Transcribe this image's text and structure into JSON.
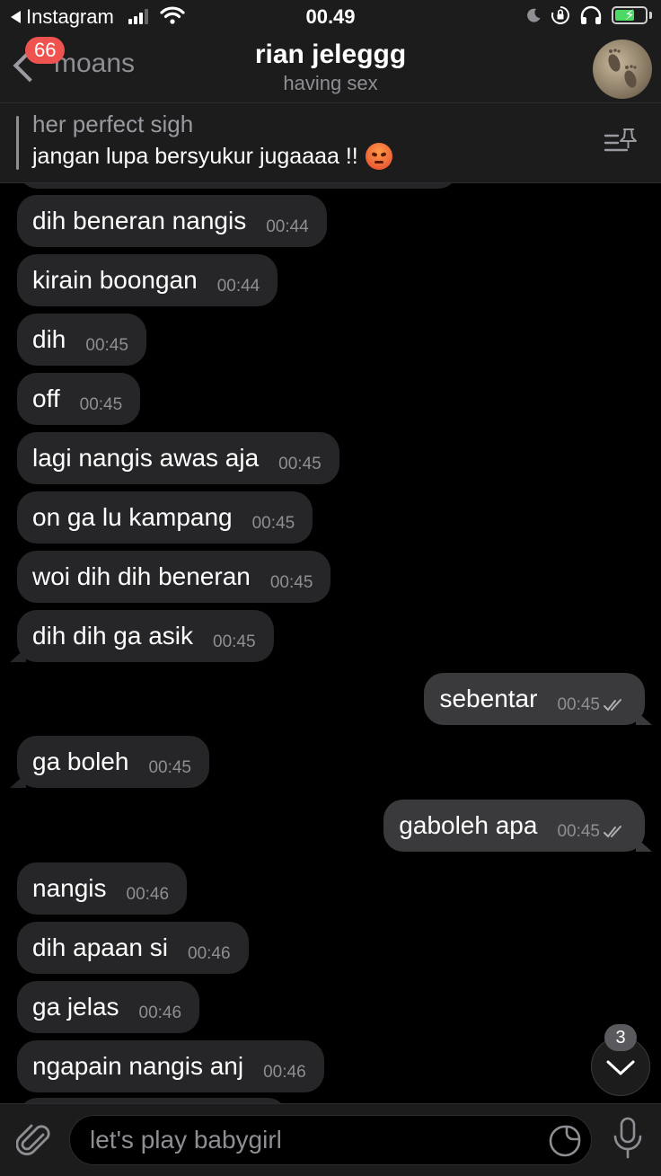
{
  "status_bar": {
    "back_app": "Instagram",
    "time": "00.49"
  },
  "header": {
    "back_label": "moans",
    "unread_badge": "66",
    "title": "rian jeleggg",
    "subtitle": "having sex"
  },
  "pinned": {
    "title": "her perfect sigh",
    "text": "jangan lupa bersyukur jugaaaa !!"
  },
  "messages": [
    {
      "text": "dih beneran nangis",
      "time": "00:44",
      "dir": "in"
    },
    {
      "text": "kirain boongan",
      "time": "00:44",
      "dir": "in"
    },
    {
      "text": "dih",
      "time": "00:45",
      "dir": "in"
    },
    {
      "text": "off",
      "time": "00:45",
      "dir": "in"
    },
    {
      "text": "lagi nangis awas aja",
      "time": "00:45",
      "dir": "in"
    },
    {
      "text": "on ga lu kampang",
      "time": "00:45",
      "dir": "in"
    },
    {
      "text": "woi dih dih beneran",
      "time": "00:45",
      "dir": "in"
    },
    {
      "text": "dih dih ga asik",
      "time": "00:45",
      "dir": "in"
    },
    {
      "text": "sebentar",
      "time": "00:45",
      "dir": "out"
    },
    {
      "text": "ga boleh",
      "time": "00:45",
      "dir": "in"
    },
    {
      "text": "gaboleh apa",
      "time": "00:45",
      "dir": "out"
    },
    {
      "text": "nangis",
      "time": "00:46",
      "dir": "in"
    },
    {
      "text": "dih apaan si",
      "time": "00:46",
      "dir": "in"
    },
    {
      "text": "ga jelas",
      "time": "00:46",
      "dir": "in"
    },
    {
      "text": "ngapain nangis anj",
      "time": "00:46",
      "dir": "in"
    }
  ],
  "scroll_down": {
    "unread_count": "3"
  },
  "composer": {
    "placeholder": "let's play babygirl"
  },
  "colors": {
    "incoming_bubble": "#262628",
    "outgoing_bubble": "#3a3a3c",
    "badge": "#ef5350",
    "battery": "#4cd964"
  }
}
